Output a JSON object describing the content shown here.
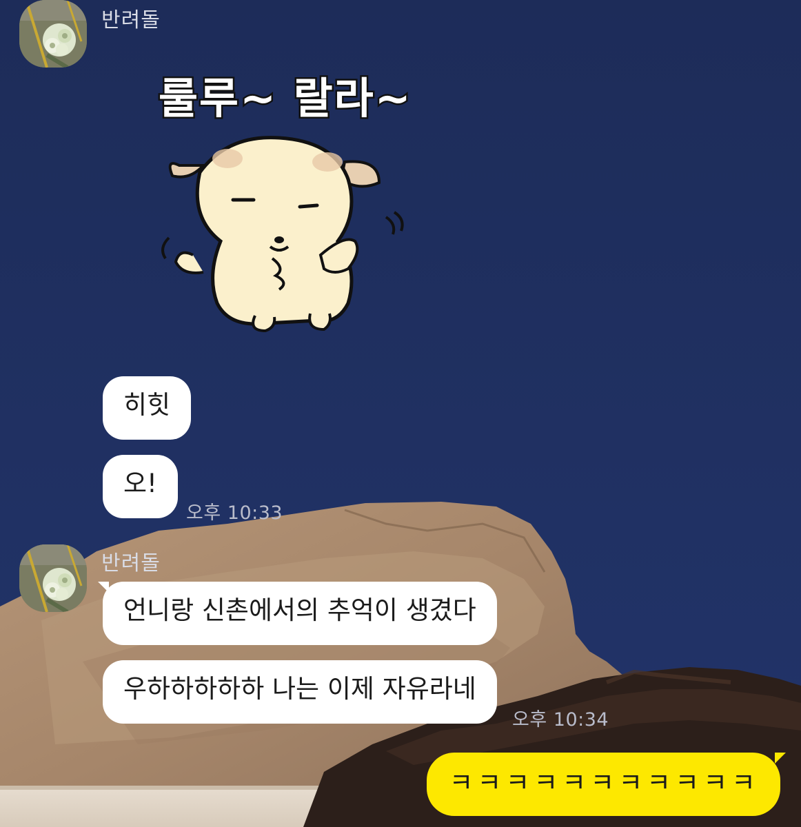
{
  "messages": {
    "group1": {
      "sender_name": "반려돌",
      "sticker_text": "룰루~ 랄라~",
      "bubble1": "히힛",
      "bubble2": "오!",
      "time": "오후 10:33"
    },
    "group2": {
      "sender_name": "반려돌",
      "bubble1": "언니랑 신촌에서의 추억이 생겼다",
      "bubble2": "우하하하하하 나는 이제 자유라네",
      "time": "오후 10:34"
    },
    "mine": {
      "bubble1": "ㅋㅋㅋㅋㅋㅋㅋㅋㅋㅋㅋ"
    }
  },
  "colors": {
    "sky": "#1e2f5c",
    "my_bubble": "#fde800",
    "other_bubble": "#ffffff",
    "time_text": "#b9bccb"
  },
  "icons": {
    "avatar": "flower-bouquet-photo",
    "sticker": "puppy-dancing-sticker"
  }
}
